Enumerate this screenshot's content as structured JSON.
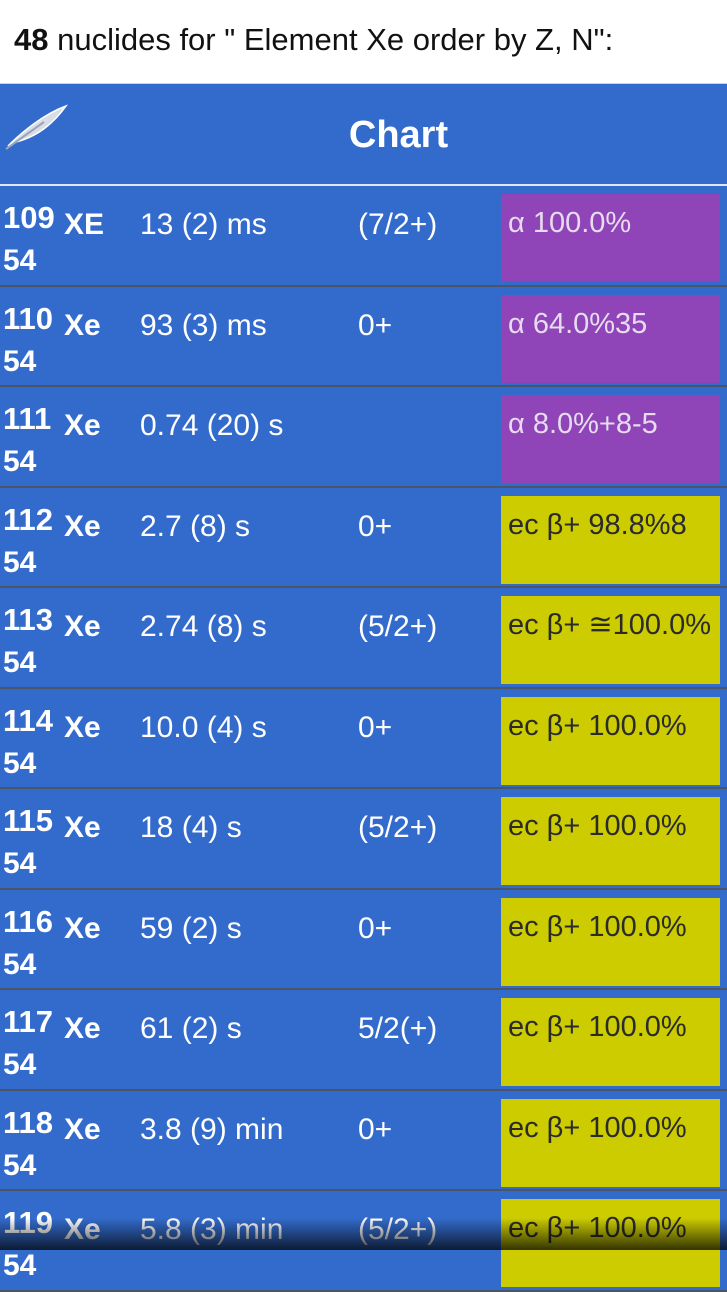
{
  "header": {
    "count": "48",
    "text": " nuclides for \" Element Xe order by Z, N\":"
  },
  "toolbar": {
    "title": "Chart",
    "icon": "feather-icon"
  },
  "colors": {
    "background": "#336bcc",
    "alpha_decay": "#8f45b8",
    "ec_decay": "#cccc00"
  },
  "rows": [
    {
      "a": "109",
      "symbol": "XE",
      "z": "54",
      "halflife": "13 (2) ms",
      "spin": "(7/2+)",
      "decay": "α 100.0%",
      "decay_type": "alpha"
    },
    {
      "a": "110",
      "symbol": "Xe",
      "z": "54",
      "halflife": "93 (3) ms",
      "spin": "0+",
      "decay": "α 64.0%35",
      "decay_type": "alpha"
    },
    {
      "a": "111",
      "symbol": "Xe",
      "z": "54",
      "halflife": "0.74 (20) s",
      "spin": "",
      "decay": "α 8.0%+8-5",
      "decay_type": "alpha"
    },
    {
      "a": "112",
      "symbol": "Xe",
      "z": "54",
      "halflife": "2.7 (8) s",
      "spin": "0+",
      "decay": "ec β+ 98.8%8",
      "decay_type": "ec"
    },
    {
      "a": "113",
      "symbol": "Xe",
      "z": "54",
      "halflife": "2.74 (8) s",
      "spin": "(5/2+)",
      "decay": "ec β+ ≅100.0%",
      "decay_type": "ec"
    },
    {
      "a": "114",
      "symbol": "Xe",
      "z": "54",
      "halflife": "10.0 (4) s",
      "spin": "0+",
      "decay": "ec β+ 100.0%",
      "decay_type": "ec"
    },
    {
      "a": "115",
      "symbol": "Xe",
      "z": "54",
      "halflife": "18 (4) s",
      "spin": "(5/2+)",
      "decay": "ec β+ 100.0%",
      "decay_type": "ec"
    },
    {
      "a": "116",
      "symbol": "Xe",
      "z": "54",
      "halflife": "59 (2) s",
      "spin": "0+",
      "decay": "ec β+ 100.0%",
      "decay_type": "ec"
    },
    {
      "a": "117",
      "symbol": "Xe",
      "z": "54",
      "halflife": "61 (2) s",
      "spin": "5/2(+)",
      "decay": "ec β+ 100.0%",
      "decay_type": "ec"
    },
    {
      "a": "118",
      "symbol": "Xe",
      "z": "54",
      "halflife": "3.8 (9) min",
      "spin": "0+",
      "decay": "ec β+ 100.0%",
      "decay_type": "ec"
    },
    {
      "a": "119",
      "symbol": "Xe",
      "z": "54",
      "halflife": "5.8 (3) min",
      "spin": "(5/2+)",
      "decay": "ec β+ 100.0%",
      "decay_type": "ec"
    }
  ]
}
